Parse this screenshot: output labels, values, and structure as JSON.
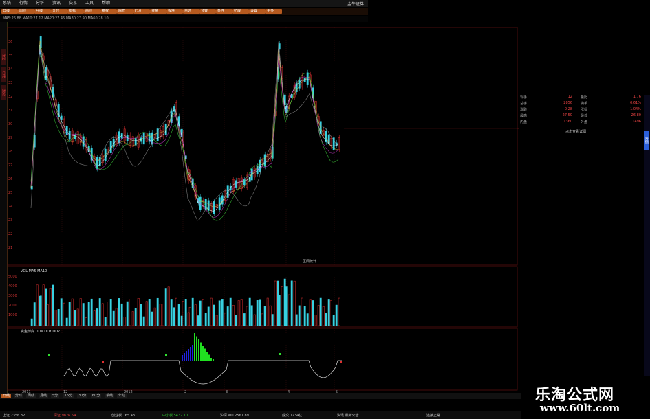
{
  "menu": {
    "items": [
      "系统",
      "行情",
      "分析",
      "资讯",
      "交易",
      "工具",
      "帮助"
    ],
    "title": "金牛证券"
  },
  "toolbar": {
    "buttons": [
      "日线",
      "周线",
      "月线",
      "分时",
      "指标",
      "画线",
      "复权",
      "除权",
      "F10",
      "资金",
      "板块",
      "自选",
      "预警",
      "条件",
      "扩展",
      "设置",
      "更多"
    ]
  },
  "infobar": {
    "text": "MA5:26.88  MA10:27.12  MA20:27.45  MA30:27.90  MA60:28.10"
  },
  "side_tabs": [
    "分时",
    "日线",
    "财务"
  ],
  "price_axis": {
    "labels": [
      "36",
      "35",
      "34",
      "33",
      "32",
      "31",
      "30",
      "29",
      "28",
      "27",
      "26",
      "25",
      "24",
      "23",
      "22",
      "21"
    ]
  },
  "volume_axis": {
    "labels": [
      "5000",
      "4000",
      "3000",
      "2000",
      "1000"
    ]
  },
  "indicator_header": "资金博弈 DDX  DDY  DDZ",
  "volume_header": "VOL  MA5  MA10",
  "chart_note": "区间统计",
  "date_labels": [
    "2011",
    "12",
    "2012",
    "2",
    "3",
    "4",
    "5"
  ],
  "quote": {
    "rows": [
      {
        "label": "现手",
        "value": "12",
        "label2": "量比",
        "value2": "1.76"
      },
      {
        "label": "总手",
        "value": "2856",
        "label2": "换手",
        "value2": "0.61%"
      },
      {
        "label": "涨跌",
        "value": "+0.28",
        "label2": "涨幅",
        "value2": "1.04%"
      },
      {
        "label": "最高",
        "value": "27.50",
        "label2": "最低",
        "value2": "26.80"
      },
      {
        "label": "内盘",
        "value": "1360",
        "label2": "外盘",
        "value2": "1496"
      }
    ],
    "footer": "点击查看详细"
  },
  "right_tab": "筹码",
  "bottom_tabs": [
    "日线",
    "分时",
    "周线",
    "月线",
    "5分",
    "15分",
    "30分",
    "60分",
    "季线",
    "年线"
  ],
  "status": {
    "items": [
      "上证 2356.32",
      "深证 9876.54",
      "创业板 765.43",
      "中小板 5432.10",
      "沪深300 2567.89",
      "成交 1234亿",
      "资讯 最新公告",
      "连接正常"
    ]
  },
  "watermark": {
    "title": "乐淘公式网",
    "url": "www.60lt.com"
  }
}
